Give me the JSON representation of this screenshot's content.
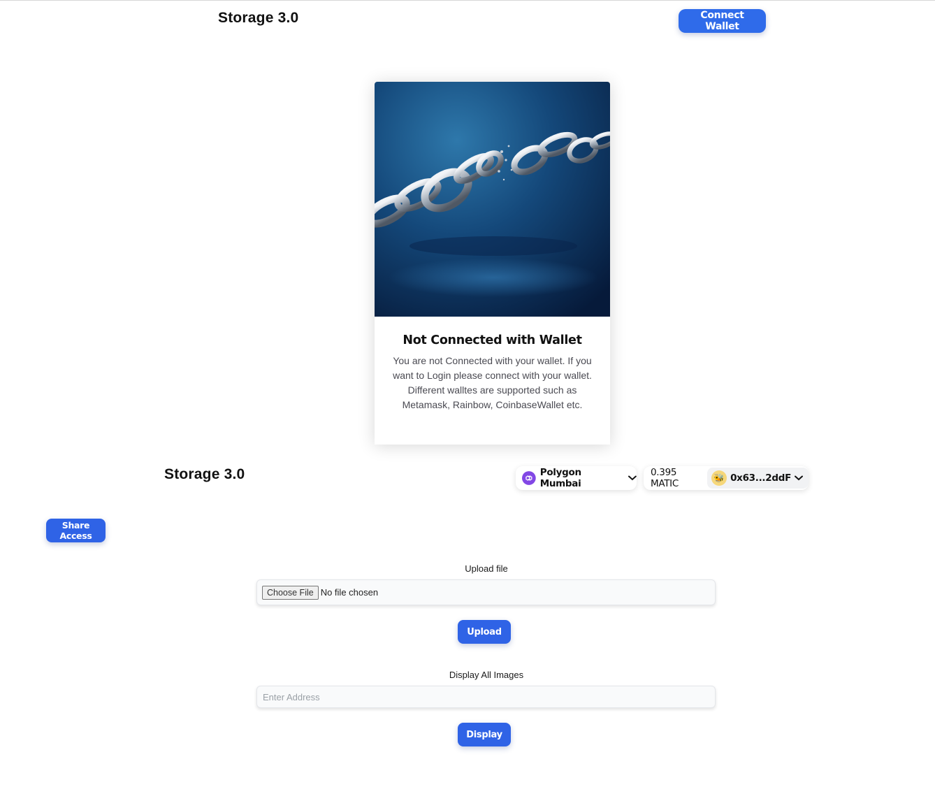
{
  "header_top": {
    "title": "Storage 3.0",
    "connect_label": "Connect Wallet"
  },
  "card": {
    "image": "broken-chain-image",
    "title": "Not Connected with Wallet",
    "body": "You are not Connected with your wallet. If you want to Login please connect with your wallet. Different walltes are supported such as Metamask, Rainbow, CoinbaseWallet etc."
  },
  "header_bottom": {
    "title": "Storage 3.0",
    "network": "Polygon Mumbai",
    "balance": "0.395 MATIC",
    "account": "0x63...2ddF"
  },
  "share": {
    "label": "Share Access"
  },
  "upload": {
    "section_label": "Upload file",
    "choose_label": "Choose File",
    "no_file_label": "No file chosen",
    "button_label": "Upload"
  },
  "display": {
    "section_label": "Display All Images",
    "input_placeholder": "Enter Address",
    "input_value": "",
    "button_label": "Display"
  },
  "colors": {
    "primary": "#2f6bea",
    "network_icon": "#8247e5"
  }
}
